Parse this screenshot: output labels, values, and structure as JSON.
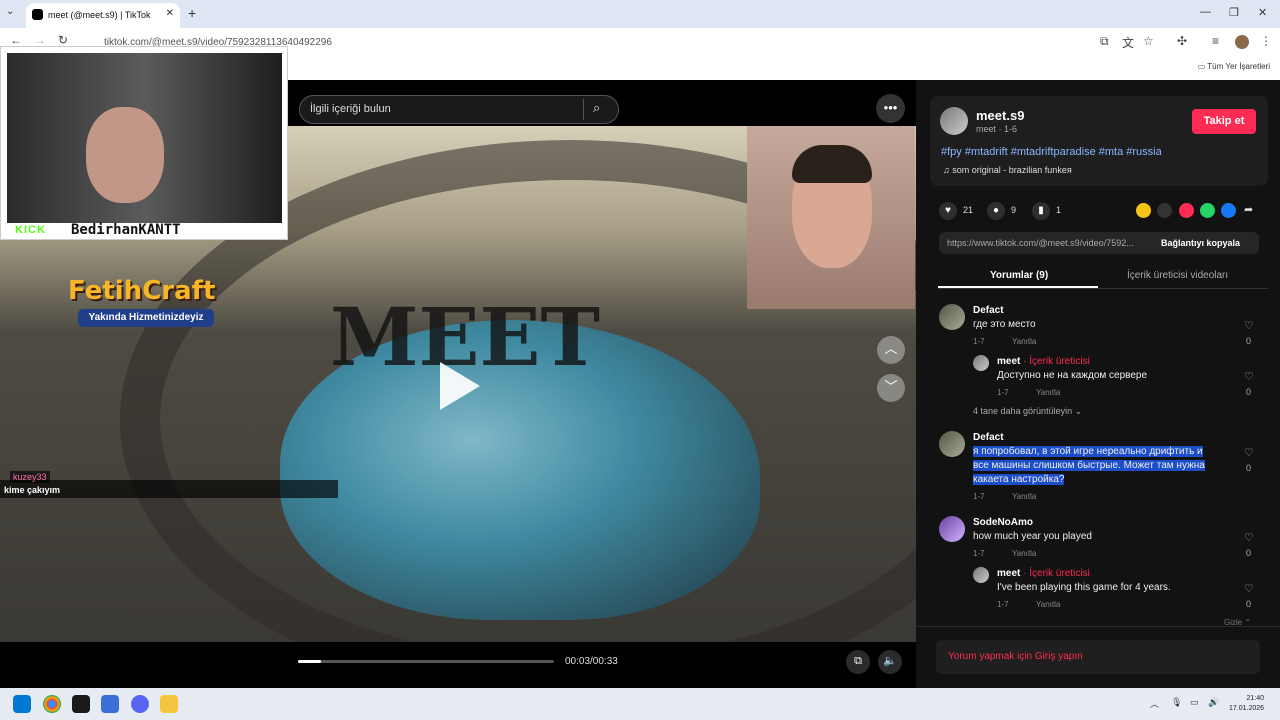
{
  "browser": {
    "tab_title": "meet (@meet.s9) | TikTok",
    "tab_close": "✕",
    "new_tab": "+",
    "url": "tiktok.com/@meet.s9/video/7592328113640492296",
    "bookmarks_folder": "Tüm Yer İşaretleri"
  },
  "video": {
    "search_placeholder": "İlgili içeriği bulun",
    "more_label": "•••",
    "overlay_logo_text": "MEET",
    "time": "00:03/00:33",
    "progress": 0.09
  },
  "stream_overlay": {
    "platform": "KICK",
    "streamer": "BedirhanKANTT",
    "fetih_title": "FetihCraft",
    "fetih_sub": "Yakında Hizmetinizdeyiz",
    "chat_user": "kuzey33",
    "chat_message": "kime çakıyım"
  },
  "author": {
    "name": "meet.s9",
    "meta": "meet · 1-6",
    "follow_label": "Takip et",
    "hashtags": "#fpy #mtadrift #mtadriftparadise #mta #russia",
    "music": "som original - brazilian funkея",
    "likes": "21",
    "comments": "9",
    "saves": "1"
  },
  "link": {
    "url": "https://www.tiktok.com/@meet.s9/video/7592...",
    "copy_label": "Bağlantıyı kopyala"
  },
  "tabs": {
    "comments": "Yorumlar (9)",
    "creator_videos": "İçerik üreticisi videoları"
  },
  "comments": [
    {
      "user": "Defact",
      "text": "где это место",
      "date": "1-7",
      "reply": "Yanıtla",
      "likes": "0"
    },
    {
      "user": "meet",
      "badge": " · İçerik üreticisi",
      "text": "Доступно не на каждом сервере",
      "date": "1-7",
      "reply": "Yanıtla",
      "likes": "0"
    },
    {
      "user": "Defact",
      "text": "я попробовал, в этой игре нереально дрифтить и все машины слишком быстрые. Может там нужна какаета настройка?",
      "date": "1-7",
      "reply": "Yanıtla",
      "likes": "0"
    },
    {
      "user": "SodeNoAmo",
      "text": "how much year you played",
      "date": "1-7",
      "reply": "Yanıtla",
      "likes": "0"
    },
    {
      "user": "meet",
      "badge": " · İçerik üreticisi",
      "text": "I've been playing this game for 4 years.",
      "date": "1-7",
      "reply": "Yanıtla",
      "likes": "0"
    }
  ],
  "more_replies": "4 tane daha görüntüleyin ⌄",
  "hide": "Gizle ⌃",
  "login_prompt": "Yorum yapmak için Giriş yapın",
  "taskbar": {
    "time": "21:40",
    "date": "17.01.2026"
  }
}
